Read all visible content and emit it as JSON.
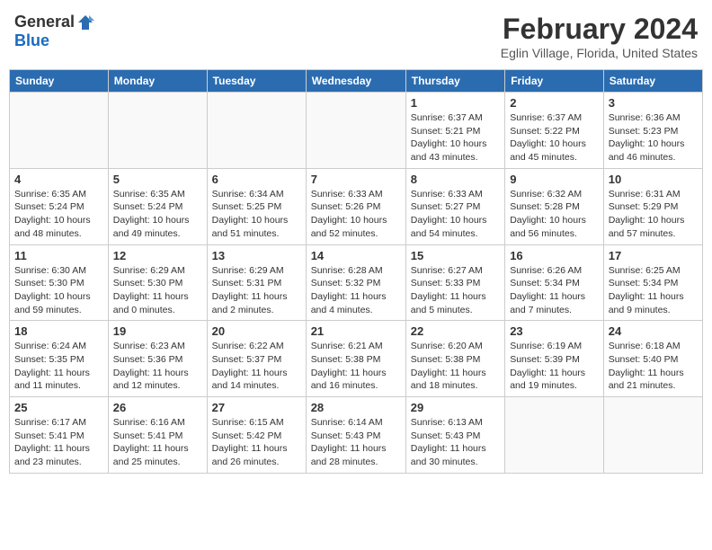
{
  "header": {
    "logo_general": "General",
    "logo_blue": "Blue",
    "month_title": "February 2024",
    "location": "Eglin Village, Florida, United States"
  },
  "days_of_week": [
    "Sunday",
    "Monday",
    "Tuesday",
    "Wednesday",
    "Thursday",
    "Friday",
    "Saturday"
  ],
  "weeks": [
    [
      {
        "day": "",
        "info": ""
      },
      {
        "day": "",
        "info": ""
      },
      {
        "day": "",
        "info": ""
      },
      {
        "day": "",
        "info": ""
      },
      {
        "day": "1",
        "info": "Sunrise: 6:37 AM\nSunset: 5:21 PM\nDaylight: 10 hours and 43 minutes."
      },
      {
        "day": "2",
        "info": "Sunrise: 6:37 AM\nSunset: 5:22 PM\nDaylight: 10 hours and 45 minutes."
      },
      {
        "day": "3",
        "info": "Sunrise: 6:36 AM\nSunset: 5:23 PM\nDaylight: 10 hours and 46 minutes."
      }
    ],
    [
      {
        "day": "4",
        "info": "Sunrise: 6:35 AM\nSunset: 5:24 PM\nDaylight: 10 hours and 48 minutes."
      },
      {
        "day": "5",
        "info": "Sunrise: 6:35 AM\nSunset: 5:24 PM\nDaylight: 10 hours and 49 minutes."
      },
      {
        "day": "6",
        "info": "Sunrise: 6:34 AM\nSunset: 5:25 PM\nDaylight: 10 hours and 51 minutes."
      },
      {
        "day": "7",
        "info": "Sunrise: 6:33 AM\nSunset: 5:26 PM\nDaylight: 10 hours and 52 minutes."
      },
      {
        "day": "8",
        "info": "Sunrise: 6:33 AM\nSunset: 5:27 PM\nDaylight: 10 hours and 54 minutes."
      },
      {
        "day": "9",
        "info": "Sunrise: 6:32 AM\nSunset: 5:28 PM\nDaylight: 10 hours and 56 minutes."
      },
      {
        "day": "10",
        "info": "Sunrise: 6:31 AM\nSunset: 5:29 PM\nDaylight: 10 hours and 57 minutes."
      }
    ],
    [
      {
        "day": "11",
        "info": "Sunrise: 6:30 AM\nSunset: 5:30 PM\nDaylight: 10 hours and 59 minutes."
      },
      {
        "day": "12",
        "info": "Sunrise: 6:29 AM\nSunset: 5:30 PM\nDaylight: 11 hours and 0 minutes."
      },
      {
        "day": "13",
        "info": "Sunrise: 6:29 AM\nSunset: 5:31 PM\nDaylight: 11 hours and 2 minutes."
      },
      {
        "day": "14",
        "info": "Sunrise: 6:28 AM\nSunset: 5:32 PM\nDaylight: 11 hours and 4 minutes."
      },
      {
        "day": "15",
        "info": "Sunrise: 6:27 AM\nSunset: 5:33 PM\nDaylight: 11 hours and 5 minutes."
      },
      {
        "day": "16",
        "info": "Sunrise: 6:26 AM\nSunset: 5:34 PM\nDaylight: 11 hours and 7 minutes."
      },
      {
        "day": "17",
        "info": "Sunrise: 6:25 AM\nSunset: 5:34 PM\nDaylight: 11 hours and 9 minutes."
      }
    ],
    [
      {
        "day": "18",
        "info": "Sunrise: 6:24 AM\nSunset: 5:35 PM\nDaylight: 11 hours and 11 minutes."
      },
      {
        "day": "19",
        "info": "Sunrise: 6:23 AM\nSunset: 5:36 PM\nDaylight: 11 hours and 12 minutes."
      },
      {
        "day": "20",
        "info": "Sunrise: 6:22 AM\nSunset: 5:37 PM\nDaylight: 11 hours and 14 minutes."
      },
      {
        "day": "21",
        "info": "Sunrise: 6:21 AM\nSunset: 5:38 PM\nDaylight: 11 hours and 16 minutes."
      },
      {
        "day": "22",
        "info": "Sunrise: 6:20 AM\nSunset: 5:38 PM\nDaylight: 11 hours and 18 minutes."
      },
      {
        "day": "23",
        "info": "Sunrise: 6:19 AM\nSunset: 5:39 PM\nDaylight: 11 hours and 19 minutes."
      },
      {
        "day": "24",
        "info": "Sunrise: 6:18 AM\nSunset: 5:40 PM\nDaylight: 11 hours and 21 minutes."
      }
    ],
    [
      {
        "day": "25",
        "info": "Sunrise: 6:17 AM\nSunset: 5:41 PM\nDaylight: 11 hours and 23 minutes."
      },
      {
        "day": "26",
        "info": "Sunrise: 6:16 AM\nSunset: 5:41 PM\nDaylight: 11 hours and 25 minutes."
      },
      {
        "day": "27",
        "info": "Sunrise: 6:15 AM\nSunset: 5:42 PM\nDaylight: 11 hours and 26 minutes."
      },
      {
        "day": "28",
        "info": "Sunrise: 6:14 AM\nSunset: 5:43 PM\nDaylight: 11 hours and 28 minutes."
      },
      {
        "day": "29",
        "info": "Sunrise: 6:13 AM\nSunset: 5:43 PM\nDaylight: 11 hours and 30 minutes."
      },
      {
        "day": "",
        "info": ""
      },
      {
        "day": "",
        "info": ""
      }
    ]
  ]
}
